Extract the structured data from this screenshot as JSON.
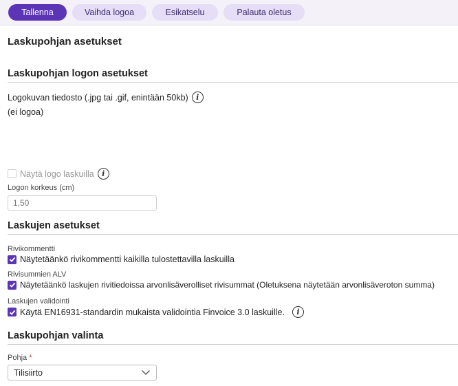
{
  "toolbar": {
    "save": "Tallenna",
    "change_logo": "Vaihda logoa",
    "preview": "Esikatselu",
    "reset": "Palauta oletus"
  },
  "page_title": "Laskupohjan asetukset",
  "logo_section": {
    "title": "Laskupohjan logon asetukset",
    "file_label": "Logokuvan tiedosto (.jpg tai .gif, enintään 50kb)",
    "no_logo": "(ei logoa)",
    "show_logo_label": "Näytä logo laskuilla",
    "show_logo_checked": false,
    "height_label": "Logon korkeus (cm)",
    "height_value": "1,50"
  },
  "invoice_section": {
    "title": "Laskujen asetukset",
    "row_comment_caption": "Rivikommentti",
    "row_comment_label": "Näytetäänkö rivikommentti kaikilla tulostettavilla laskuilla",
    "vat_caption": "Rivisummien ALV",
    "vat_label": "Näytetäänkö laskujen rivitiedoissa arvonlisäverolliset rivisummat (Oletuksena näytetään arvonlisäveroton summa)",
    "validation_caption": "Laskujen validointi",
    "validation_label": "Käytä EN16931-standardin mukaista validointia Finvoice 3.0 laskuille."
  },
  "template_section": {
    "title": "Laskupohjan valinta",
    "field_label": "Pohja",
    "required_mark": "*",
    "selected": "Tilisiirto"
  },
  "colors": {
    "accent": "#5b35b6",
    "secondary_button": "#e5def6"
  },
  "icons": {
    "info": "i",
    "check": "✓",
    "chevron": "chevron-down"
  }
}
